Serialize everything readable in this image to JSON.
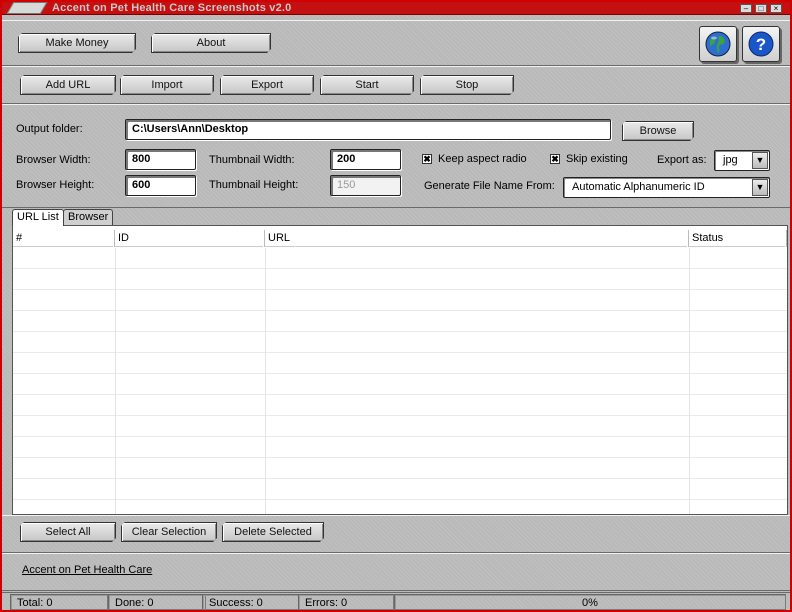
{
  "window": {
    "title": "Accent on Pet Health Care Screenshots v2.0"
  },
  "toolbar1": {
    "make_money": "Make Money",
    "about": "About"
  },
  "toolbar2": {
    "add_url": "Add URL",
    "import": "Import",
    "export": "Export",
    "start": "Start",
    "stop": "Stop"
  },
  "icons": {
    "globe": "globe-icon",
    "help": "help-icon",
    "help_glyph": "?"
  },
  "settings": {
    "output_folder_label": "Output folder:",
    "output_folder_value": "C:\\Users\\Ann\\Desktop",
    "browse": "Browse",
    "browser_width_label": "Browser Width:",
    "browser_width_value": "800",
    "browser_height_label": "Browser Height:",
    "browser_height_value": "600",
    "thumb_width_label": "Thumbnail Width:",
    "thumb_width_value": "200",
    "thumb_height_label": "Thumbnail Height:",
    "thumb_height_value": "150",
    "keep_aspect_label": "Keep aspect radio",
    "skip_existing_label": "Skip existing",
    "export_as_label": "Export as:",
    "export_as_value": "jpg",
    "gen_name_label": "Generate File Name From:",
    "gen_name_value": "Automatic Alphanumeric ID",
    "check_mark": "✖"
  },
  "tabs": {
    "url_list": "URL List",
    "browser": "Browser"
  },
  "table": {
    "columns": [
      "#",
      "ID",
      "URL",
      "Status"
    ]
  },
  "actions": {
    "select_all": "Select All",
    "clear_selection": "Clear Selection",
    "delete_selected": "Delete Selected"
  },
  "footer": {
    "link": "Accent on Pet Health Care"
  },
  "status": {
    "total": "Total: 0",
    "done": "Done: 0",
    "success": "Success: 0",
    "errors": "Errors: 0",
    "progress": "0%"
  },
  "colors": {
    "title_bar": "#c41010",
    "frame": "#d00000",
    "face": "#b9b9b9"
  }
}
